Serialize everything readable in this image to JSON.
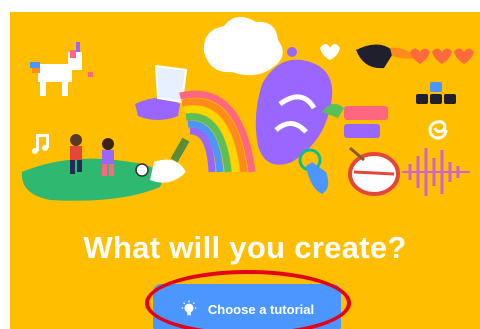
{
  "hero": {
    "headline": "What will you create?",
    "tutorial_button_label": "Choose a tutorial",
    "tutorial_button_icon": "lightbulb-icon"
  },
  "annotation": {
    "shape": "ellipse",
    "target": "choose-tutorial-button",
    "color": "#E4001A"
  },
  "colors": {
    "background": "#FFBF00",
    "button": "#4C97FF",
    "headline": "#ffffff"
  },
  "illustration": {
    "icons": [
      "unicorn-icon",
      "paint-bucket-icon",
      "rainbow-icon",
      "cloud-icon",
      "toucan-icon",
      "hearts-icon",
      "arrow-keys-icon",
      "spiral-icon",
      "kids-playing-soccer-icon",
      "music-notes-icon",
      "paint-splash-icon",
      "tap-hand-icon",
      "drum-icon",
      "sound-wave-icon",
      "code-blocks-icon"
    ]
  }
}
